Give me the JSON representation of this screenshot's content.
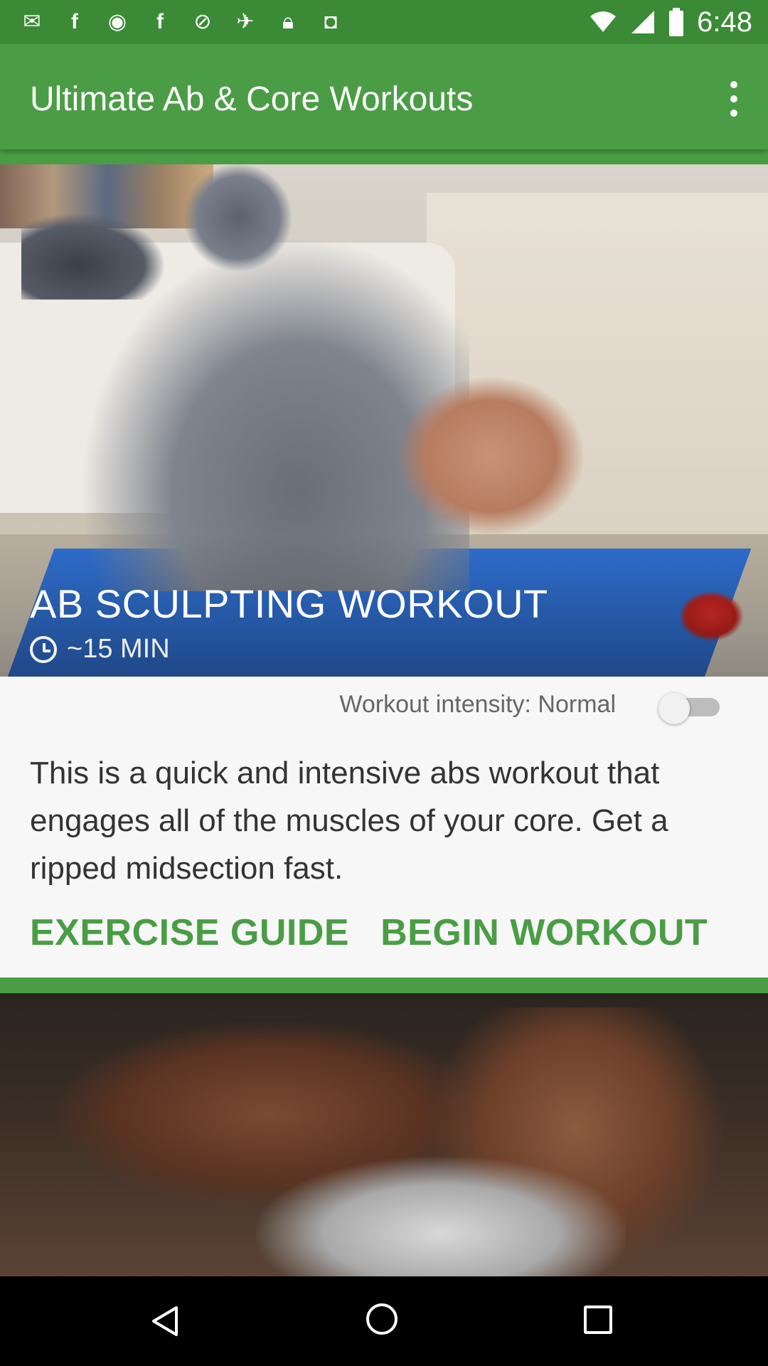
{
  "status_bar": {
    "time": "6:48",
    "icons": [
      "mail-icon",
      "facebook-icon",
      "vpn-eye-icon",
      "facebook-icon",
      "settings-icon",
      "fake-gps-icon",
      "lock-icon",
      "android-icon"
    ],
    "right_icons": [
      "wifi-icon",
      "signal-icon",
      "battery-icon"
    ]
  },
  "app_bar": {
    "title": "Ultimate Ab & Core Workouts",
    "menu_icon": "more-vert-icon"
  },
  "workout_card": {
    "title": "AB SCULPTING WORKOUT",
    "duration": "~15 MIN",
    "duration_icon": "alarm-clock-icon",
    "intensity_label": "Workout intensity: Normal",
    "intensity_toggle_on": false,
    "description": "This is a quick and intensive abs workout that engages all of the muscles of your core. Get a ripped midsection fast.",
    "exercise_guide_label": "EXERCISE GUIDE",
    "begin_workout_label": "BEGIN WORKOUT"
  },
  "colors": {
    "primary": "#4a9d45",
    "primary_dark": "#3a8a36",
    "accent_text": "#4a9d45",
    "card_bg": "#f7f7f7"
  },
  "nav_bar": {
    "buttons": [
      "back-icon",
      "home-icon",
      "recent-apps-icon"
    ]
  }
}
